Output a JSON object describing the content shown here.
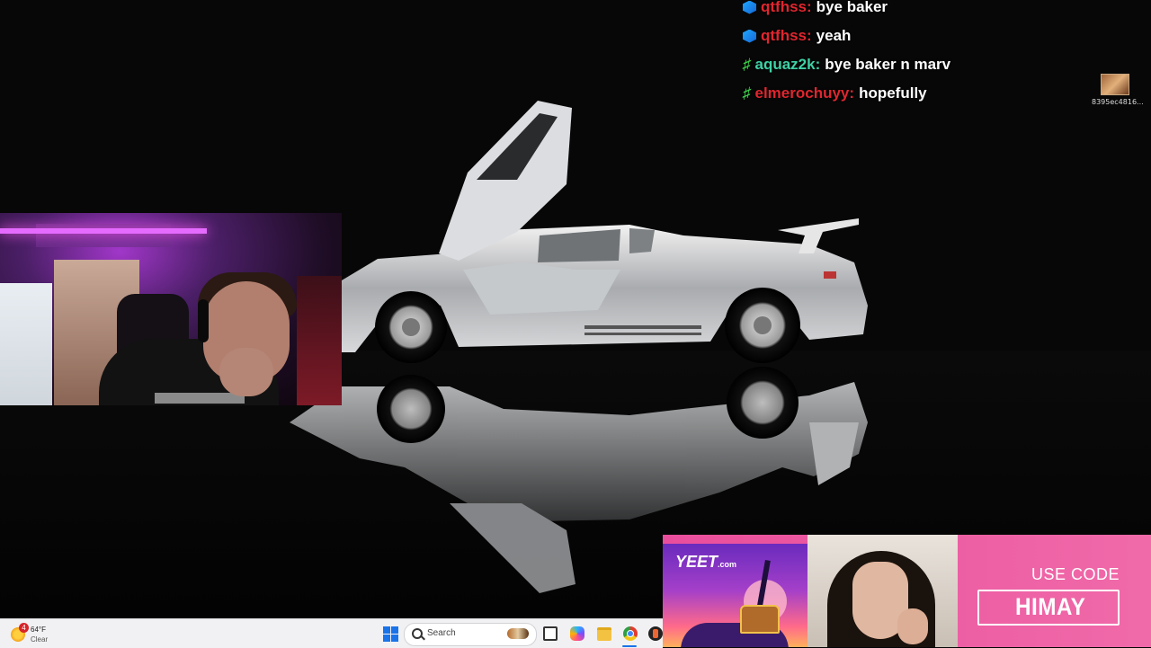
{
  "chat": {
    "messages": [
      {
        "user": "qtfhss",
        "user_color": "#e0262f",
        "badge": "cube",
        "text": "bye baker"
      },
      {
        "user": "qtfhss",
        "user_color": "#e0262f",
        "badge": "cube",
        "text": "yeah"
      },
      {
        "user": "aquaz2k",
        "user_color": "#3fd1a6",
        "badge": "hash",
        "text": "bye baker n marv"
      },
      {
        "user": "elmerochuyy",
        "user_color": "#e0262f",
        "badge": "hash",
        "text": "hopefully"
      }
    ]
  },
  "desktop_icon": {
    "label": "8395ec4816..."
  },
  "ad": {
    "brand": "YEET",
    "brand_suffix": ".com",
    "use_code_label": "USE CODE",
    "code": "HIMAY",
    "accent": "#ec5aa2"
  },
  "taskbar": {
    "weather_badge": "4",
    "temperature": "64°F",
    "condition": "Clear",
    "search_placeholder": "Search",
    "icons": [
      "start-icon",
      "search-icon",
      "task-view-icon",
      "copilot-icon",
      "file-explorer-icon",
      "chrome-icon",
      "app-icon"
    ]
  }
}
